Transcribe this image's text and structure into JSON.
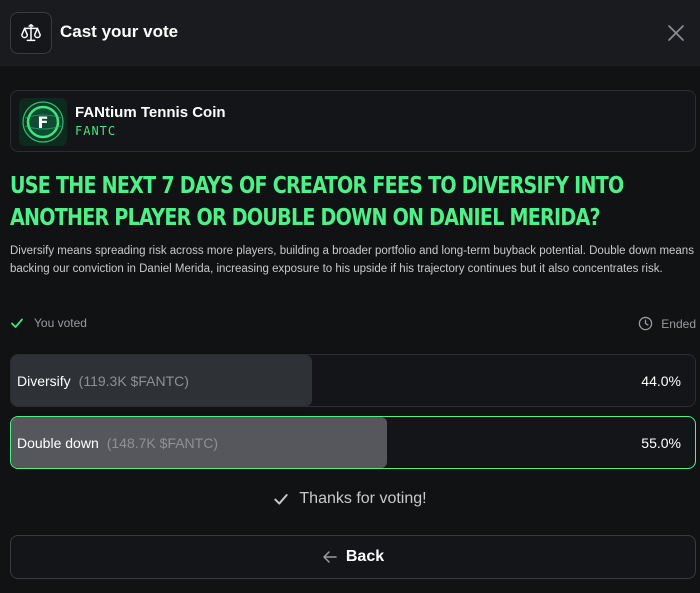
{
  "header": {
    "title": "Cast your vote",
    "icon": "scale-icon"
  },
  "token": {
    "name": "FANtium Tennis Coin",
    "ticker": "FANTC",
    "logo_letter": "F",
    "accent_color": "#4cf287"
  },
  "proposal": {
    "question": "Use the next 7 days of creator fees to diversify into another player or double down on Daniel Merida?",
    "description": "Diversify means spreading risk across more players, building a broader portfolio and long-term buyback potential. Double down means backing our conviction in Daniel Merida, increasing exposure to his upside if his trajectory continues but it also concentrates risk."
  },
  "status": {
    "voted_text": "You voted",
    "ended_text": "Ended"
  },
  "options": [
    {
      "label": "Diversify",
      "amount": "(119.3K $FANTC)",
      "percent_text": "44.0%",
      "percent": 44.0,
      "selected": false
    },
    {
      "label": "Double down",
      "amount": "(148.7K $FANTC)",
      "percent_text": "55.0%",
      "percent": 55.0,
      "selected": true
    }
  ],
  "footer": {
    "thanks_text": "Thanks for voting!",
    "back_label": "Back"
  }
}
